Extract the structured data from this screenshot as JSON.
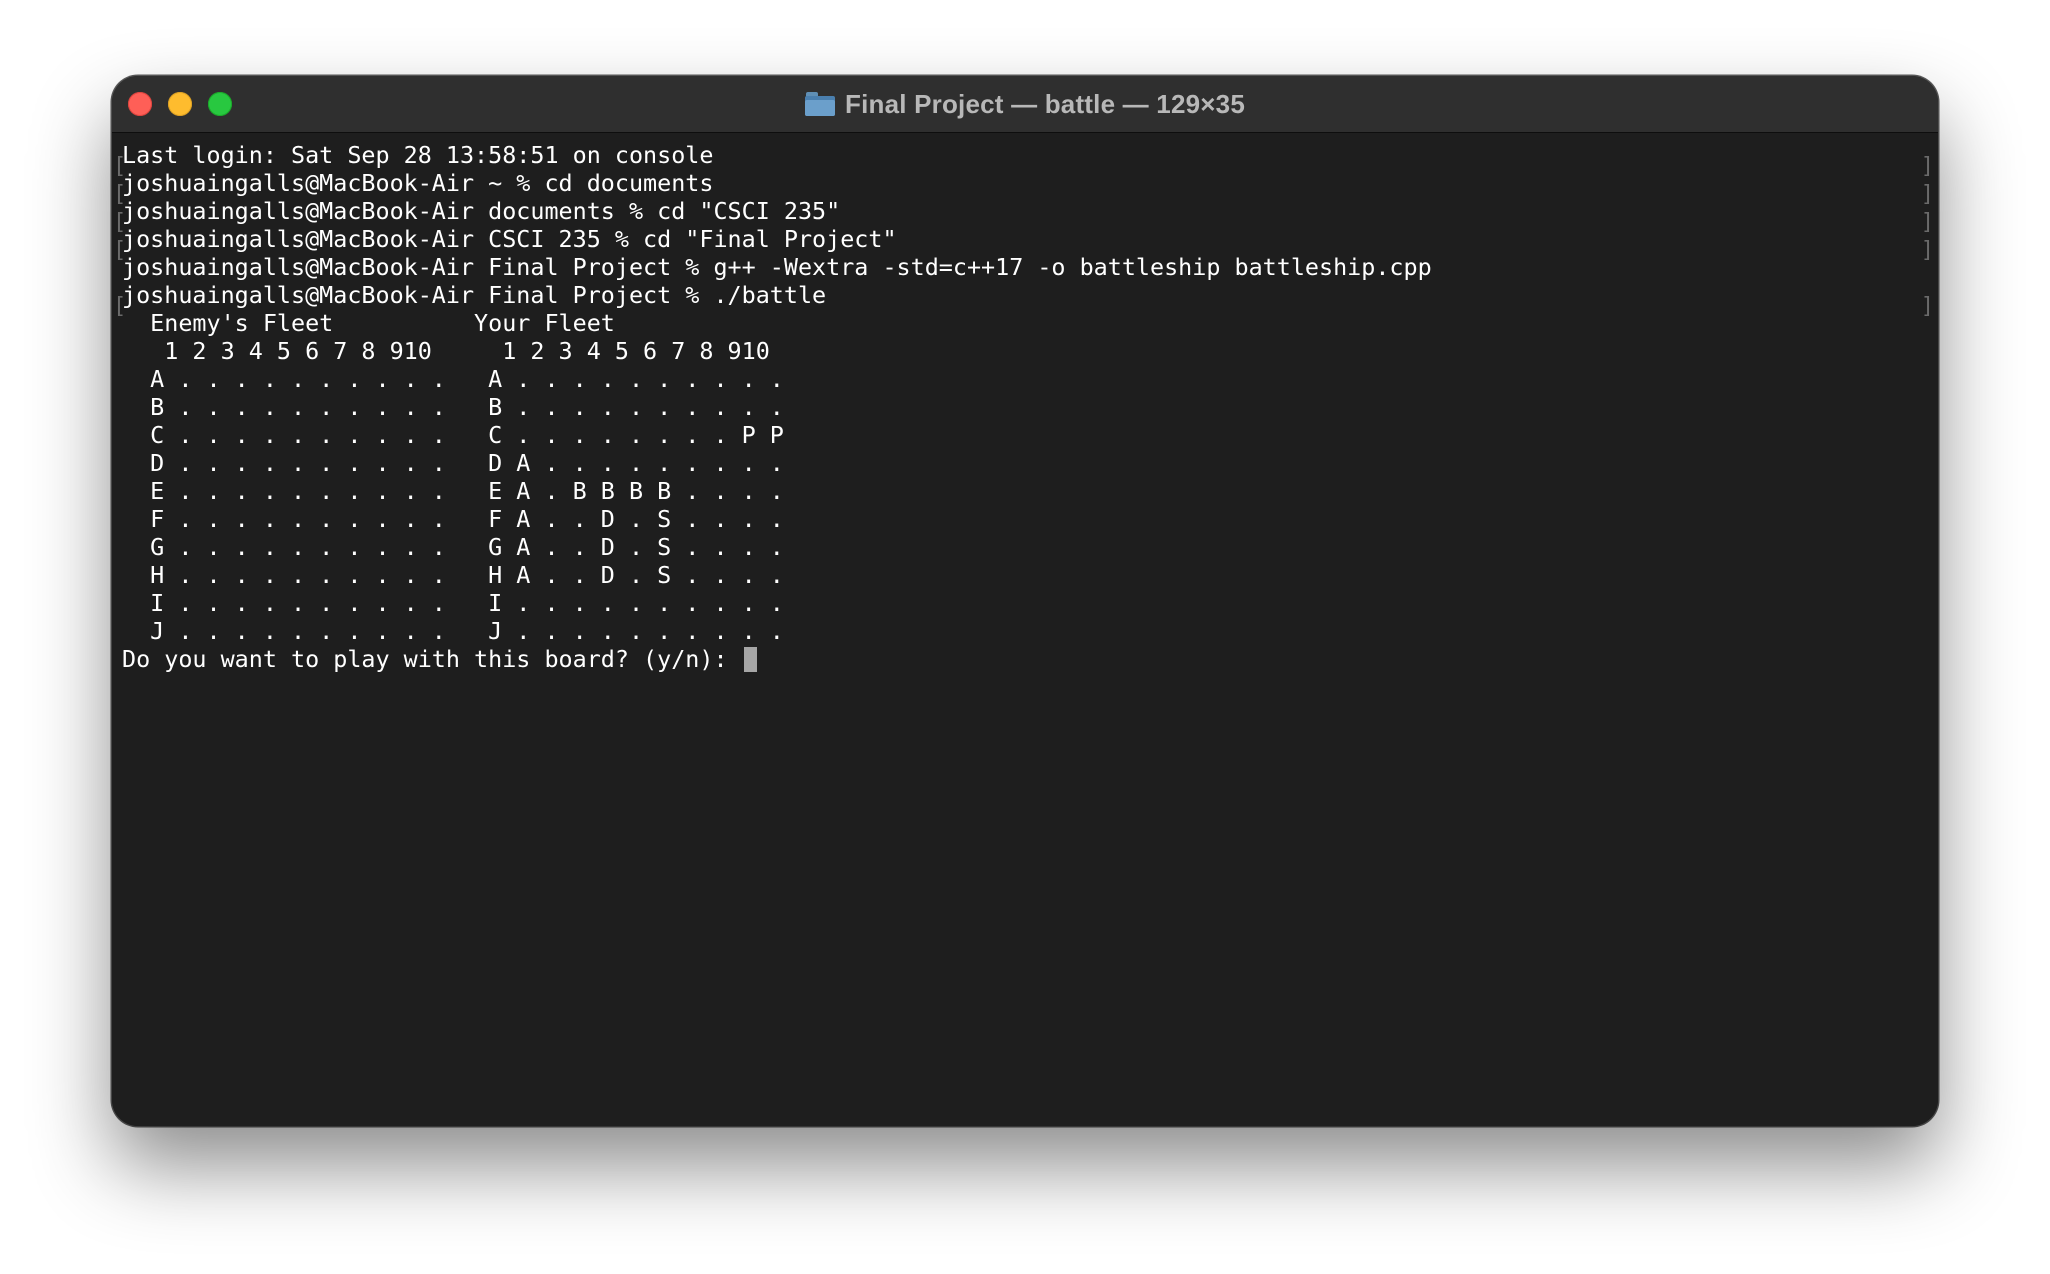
{
  "window": {
    "title": "Final Project — battle — 129×35",
    "colors": {
      "close": "#fe5f57",
      "minimize": "#febc2e",
      "zoom": "#28c840",
      "terminal_bg": "#1e1e1e",
      "text": "#ffffff",
      "cursor": "#a6a6a6"
    }
  },
  "terminal": {
    "lines": [
      "Last login: Sat Sep 28 13:58:51 on console",
      "joshuaingalls@MacBook-Air ~ % cd documents",
      "joshuaingalls@MacBook-Air documents % cd \"CSCI 235\"",
      "joshuaingalls@MacBook-Air CSCI 235 % cd \"Final Project\"",
      "joshuaingalls@MacBook-Air Final Project % g++ -Wextra -std=c++17 -o battleship battleship.cpp",
      "joshuaingalls@MacBook-Air Final Project % ./battle",
      "  Enemy's Fleet          Your Fleet",
      "   1 2 3 4 5 6 7 8 910     1 2 3 4 5 6 7 8 910",
      "  A . . . . . . . . . .   A . . . . . . . . . .",
      "  B . . . . . . . . . .   B . . . . . . . . . .",
      "  C . . . . . . . . . .   C . . . . . . . . P P",
      "  D . . . . . . . . . .   D A . . . . . . . . .",
      "  E . . . . . . . . . .   E A . B B B B . . . .",
      "  F . . . . . . . . . .   F A . . D . S . . . .",
      "  G . . . . . . . . . .   G A . . D . S . . . .",
      "  H . . . . . . . . . .   H A . . D . S . . . .",
      "  I . . . . . . . . . .   I . . . . . . . . . .",
      "  J . . . . . . . . . .   J . . . . . . . . . ."
    ],
    "prompt": "Do you want to play with this board? (y/n): "
  }
}
